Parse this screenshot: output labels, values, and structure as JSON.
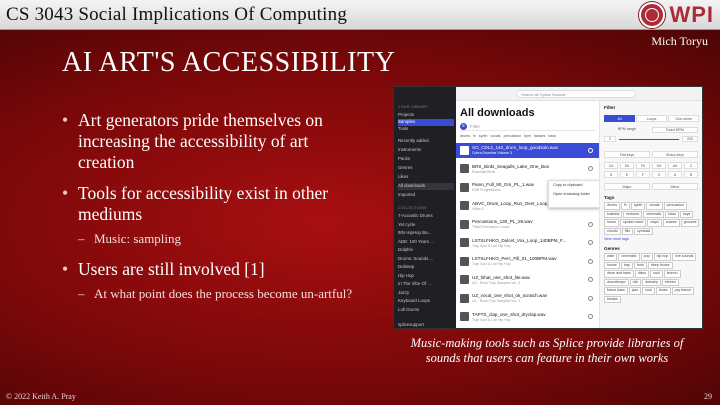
{
  "header": {
    "course_title": "CS 3043 Social Implications Of Computing",
    "logo_text": "WPI",
    "presenter": "Mich Toryu"
  },
  "slide": {
    "title": "AI ART'S ACCESSIBILITY",
    "bullets": [
      {
        "text": "Art generators pride themselves on increasing the accessibility of art creation",
        "sub": []
      },
      {
        "text": "Tools for accessibility exist in other mediums",
        "sub": [
          "Music: sampling"
        ]
      },
      {
        "text": "Users are still involved [1]",
        "sub": [
          "At what point does the process become un-artful?"
        ]
      }
    ],
    "caption": "Music-making tools such as Splice provide libraries of sounds that users can feature in their own works"
  },
  "footer": {
    "copyright": "© 2022 Keith A. Pray",
    "page_number": "29"
  },
  "screenshot": {
    "search_placeholder": "Search all Splice Sounds",
    "sidebar_header": "YOUR LIBRARY",
    "sidebar_top": [
      "Projects",
      "Samples",
      "Tools"
    ],
    "sidebar_active": "Samples",
    "sidebar_library": [
      "Recently added",
      "Instruments",
      "Packs",
      "Genres",
      "Likes",
      "All downloads",
      "Imported"
    ],
    "collections_header": "COLLECTIONS",
    "collections": [
      "T-Acoustic Drums",
      "Yet cycle",
      "90s HipHop Ba...",
      "ADE: 100 Years ...",
      "Dolphin",
      "Drums: Sounds ...",
      "Dubstep",
      "Hip Hop",
      "In The Vibe Of ...",
      "Jazzy",
      "Keyboard Loops",
      "Lofi Drums"
    ],
    "account": "splicesupport",
    "main_title": "All downloads",
    "filter_placeholder": "Filter",
    "tags": [
      "drums",
      "fx",
      "synth",
      "vocals",
      "percussion",
      "bpm",
      "basses",
      "bass"
    ],
    "rows": [
      {
        "name": "SO_CDL2_140_drum_loop_goodsolo.wav",
        "sub": "Cobra Drumline Volume 3",
        "selected": true
      },
      {
        "name": "BRS_Birds_Seagulls_Lake_One_Bus",
        "sub": "Essential Birds",
        "selected": false
      },
      {
        "name": "Piano_Full_90_Gm_PL_1.wav",
        "sub": "R&B Progressions",
        "selected": false
      },
      {
        "name": "ABVC_Drum_Loop_Run_Over_Loop_140B...",
        "sub": "Vibes 3",
        "selected": false
      },
      {
        "name": "Percussions_130_PL_28.wav",
        "sub": "Tribal Percussion Loops",
        "selected": false
      },
      {
        "name": "LSTSLFHKO_Dulcet_Vox_Loop_140BPM_F...",
        "sub": "Trap Soul & Lofi Hip Hop",
        "selected": false
      },
      {
        "name": "LSTSLFHKO_Perc_Fill_01_100BPM.wav",
        "sub": "Trap Soul & Lofi Hip Hop",
        "selected": false
      },
      {
        "name": "UZ_hihat_one_shot_lite.wav",
        "sub": "UZ - Rock Trap Samples Vol. 2",
        "selected": false
      },
      {
        "name": "UZ_vocal_one_shot_ok_scratch.wav",
        "sub": "UZ - Rock Trap Samples Vol. 2",
        "selected": false
      },
      {
        "name": "TAPTS_clap_one_shot_dryclap.wav",
        "sub": "Trap Soul & Lofi Hip Hop",
        "selected": false
      }
    ],
    "context_menu": [
      "Copy to clipboard",
      "Open enclosing folder"
    ],
    "filter_panel": {
      "title": "Filter",
      "type_buttons": [
        "All",
        "Loops",
        "One-shots"
      ],
      "bpm_label": "BPM range",
      "bpm_exact": "Exact BPM",
      "bpm_min": "0",
      "bpm_max": "200",
      "key_buttons": [
        "Flat keys",
        "Sharp keys"
      ],
      "keys": [
        "C#",
        "D#",
        "F#",
        "G#",
        "A#",
        "C",
        "D",
        "E",
        "F",
        "G",
        "A",
        "B"
      ],
      "scale_buttons": [
        "Major",
        "Minor"
      ],
      "tags_header": "Tags",
      "tags": [
        "drums",
        "fx",
        "synth",
        "vocals",
        "percussion",
        "kalimba",
        "textures",
        "cinematic",
        "bass",
        "keys",
        "horns",
        "spoken word",
        "claps",
        "snares",
        "grooves",
        "chords",
        "fills",
        "cymbals"
      ],
      "view_more": "View more tags",
      "genres_header": "Genres",
      "genres": [
        "wide",
        "cinematic",
        "pop",
        "hip hop",
        "live sounds",
        "house",
        "trap",
        "funk",
        "deep house",
        "drum and bass",
        "disco",
        "soul",
        "techno",
        "downtempo",
        "r&b",
        "dubstep",
        "electro",
        "future bass",
        "jazz",
        "rock",
        "blues",
        "psy trance",
        "breaks"
      ]
    }
  }
}
